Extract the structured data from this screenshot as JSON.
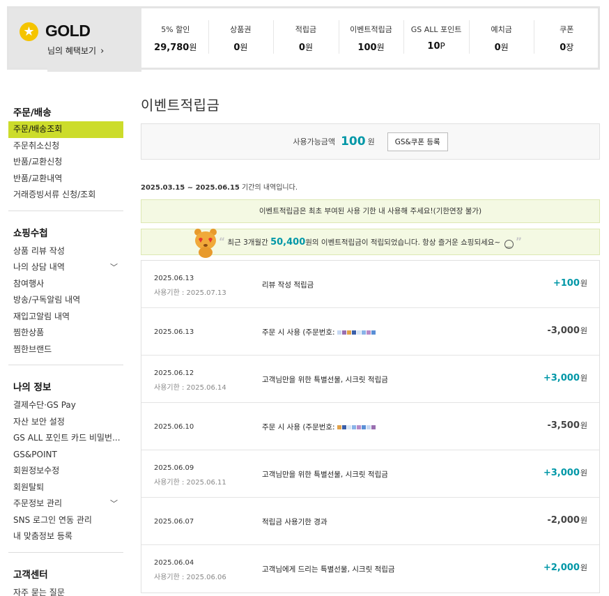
{
  "header": {
    "grade": "GOLD",
    "benefit_link": "님의 혜택보기",
    "stats": [
      {
        "label": "5% 할인",
        "value": "29,780",
        "unit": "원"
      },
      {
        "label": "상품권",
        "value": "0",
        "unit": "원"
      },
      {
        "label": "적립금",
        "value": "0",
        "unit": "원"
      },
      {
        "label": "이벤트적립금",
        "value": "100",
        "unit": "원"
      },
      {
        "label": "GS ALL 포인트",
        "value": "10",
        "unit": "P"
      },
      {
        "label": "예치금",
        "value": "0",
        "unit": "원"
      },
      {
        "label": "쿠폰",
        "value": "0",
        "unit": "장"
      }
    ]
  },
  "sidebar": {
    "groups": [
      {
        "title": "주문/배송",
        "items": [
          {
            "label": "주문/배송조회",
            "active": true
          },
          {
            "label": "주문취소신청"
          },
          {
            "label": "반품/교환신청"
          },
          {
            "label": "반품/교환내역"
          },
          {
            "label": "거래증빙서류 신청/조회"
          }
        ]
      },
      {
        "title": "쇼핑수첩",
        "items": [
          {
            "label": "상품 리뷰 작성"
          },
          {
            "label": "나의 상담 내역",
            "expand": true
          },
          {
            "label": "참여행사"
          },
          {
            "label": "방송/구독알림 내역"
          },
          {
            "label": "재입고알림 내역"
          },
          {
            "label": "찜한상품"
          },
          {
            "label": "찜한브랜드"
          }
        ]
      },
      {
        "title": "나의 정보",
        "items": [
          {
            "label": "결제수단·GS Pay"
          },
          {
            "label": "자산 보안 설정"
          },
          {
            "label": "GS ALL 포인트 카드 비밀번..."
          },
          {
            "label": "GS&POINT"
          },
          {
            "label": "회원정보수정"
          },
          {
            "label": "회원탈퇴"
          },
          {
            "label": "주문정보 관리",
            "expand": true
          },
          {
            "label": "SNS 로그인 연동 관리"
          },
          {
            "label": "내 맞춤정보 등록"
          }
        ]
      },
      {
        "title": "고객센터",
        "items": [
          {
            "label": "자주 묻는 질문"
          }
        ]
      }
    ]
  },
  "main": {
    "title": "이벤트적립금",
    "available_label": "사용가능금액",
    "available_amount": "100",
    "available_unit": "원",
    "coupon_button": "GS&쿠폰 등록",
    "period_range": "2025.03.15 ~ 2025.06.15",
    "period_suffix": " 기간의 내역입니다.",
    "notice1": "이벤트적립금은 최초 부여된 사용 기한 내 사용해 주세요!(기한연장 불가)",
    "notice2_prefix": "최근 3개월간 ",
    "notice2_amount": "50,400",
    "notice2_suffix": "원의 이벤트적립금이 적립되었습니다. 항상 즐거운 쇼핑되세요~",
    "transactions": [
      {
        "date": "2025.06.13",
        "expire": "사용기한 : 2025.07.13",
        "desc": "리뷰 작성 적립금",
        "amount": "+100",
        "unit": "원",
        "type": "plus"
      },
      {
        "date": "2025.06.13",
        "expire": "",
        "desc": "주문 시 사용 (주문번호:",
        "masked": true,
        "amount": "-3,000",
        "unit": "원",
        "type": "minus"
      },
      {
        "date": "2025.06.12",
        "expire": "사용기한 : 2025.06.14",
        "desc": "고객님만을 위한 특별선물, 시크릿 적립금",
        "amount": "+3,000",
        "unit": "원",
        "type": "plus"
      },
      {
        "date": "2025.06.10",
        "expire": "",
        "desc": "주문 시 사용 (주문번호:",
        "masked": true,
        "amount": "-3,500",
        "unit": "원",
        "type": "minus"
      },
      {
        "date": "2025.06.09",
        "expire": "사용기한 : 2025.06.11",
        "desc": "고객님만을 위한 특별선물, 시크릿 적립금",
        "amount": "+3,000",
        "unit": "원",
        "type": "plus"
      },
      {
        "date": "2025.06.07",
        "expire": "",
        "desc": "적립금 사용기한 경과",
        "amount": "-2,000",
        "unit": "원",
        "type": "minus"
      },
      {
        "date": "2025.06.04",
        "expire": "사용기한 : 2025.06.06",
        "desc": "고객님에게 드리는 특별선물, 시크릿 적립금",
        "amount": "+2,000",
        "unit": "원",
        "type": "plus"
      }
    ]
  },
  "colors": {
    "accent": "#0097a7",
    "menu_active": "#ccdc2b",
    "star": "#f5c400"
  }
}
